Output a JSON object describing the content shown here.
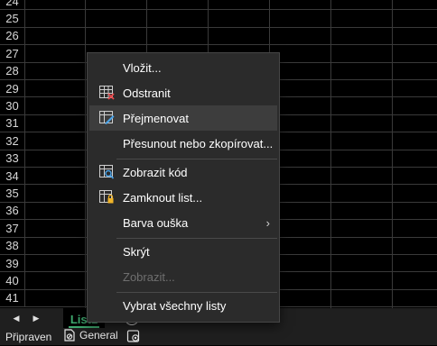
{
  "row_numbers": [
    "24",
    "25",
    "26",
    "27",
    "28",
    "29",
    "30",
    "31",
    "32",
    "33",
    "34",
    "35",
    "36",
    "37",
    "38",
    "39",
    "40",
    "41"
  ],
  "context_menu": {
    "items": [
      {
        "label": "Vložit...",
        "icon": "none"
      },
      {
        "label": "Odstranit",
        "icon": "delete-sheet-icon"
      },
      {
        "label": "Přejmenovat",
        "icon": "rename-sheet-icon"
      },
      {
        "label": "Přesunout nebo zkopírovat...",
        "icon": "none"
      },
      {
        "label": "Zobrazit kód",
        "icon": "view-code-icon"
      },
      {
        "label": "Zamknout list...",
        "icon": "protect-sheet-icon"
      },
      {
        "label": "Barva ouška",
        "icon": "none"
      },
      {
        "label": "Skrýt",
        "icon": "none"
      },
      {
        "label": "Zobrazit...",
        "icon": "none"
      },
      {
        "label": "Vybrat všechny listy",
        "icon": "none"
      }
    ]
  },
  "tabbar": {
    "prev_arrow": "◀",
    "next_arrow": "▶",
    "sheet_tab_label": "List1",
    "add_sheet": "+"
  },
  "statusbar": {
    "ready": "Připraven",
    "sensitivity": "General"
  },
  "colors": {
    "accent_green": "#3ea96f",
    "menu_bg": "#2b2b2b",
    "hover": "#3d3d3d",
    "disabled_text": "#6f6f6f"
  }
}
